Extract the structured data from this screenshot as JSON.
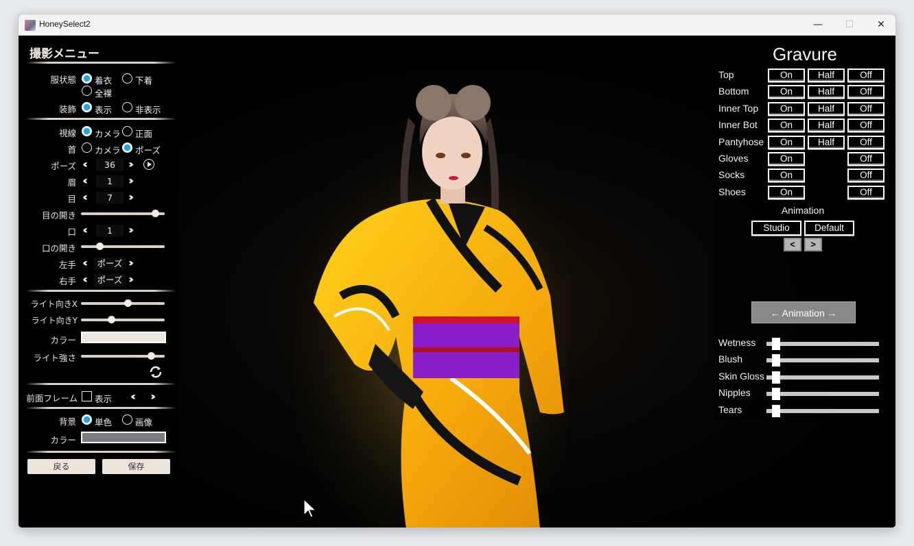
{
  "window": {
    "title": "HoneySelect2",
    "controls": {
      "minimize": "—",
      "maximize": "☐",
      "close": "✕"
    }
  },
  "left_menu": {
    "title": "撮影メニュー",
    "clothing_state": {
      "label": "服状態",
      "options": [
        "着衣",
        "下着",
        "全裸"
      ],
      "selected": "着衣"
    },
    "accessory": {
      "label": "装飾",
      "options": [
        "表示",
        "非表示"
      ],
      "selected": "表示"
    },
    "gaze": {
      "label": "視線",
      "options": [
        "カメラ",
        "正面"
      ],
      "selected": "カメラ"
    },
    "neck": {
      "label": "首",
      "options": [
        "カメラ",
        "ポーズ"
      ],
      "selected": "ポーズ"
    },
    "pose": {
      "label": "ポーズ",
      "value": "36"
    },
    "eyebrow": {
      "label": "眉",
      "value": "1"
    },
    "eye": {
      "label": "目",
      "value": "7"
    },
    "eye_open": {
      "label": "目の開き",
      "level": 0.93
    },
    "mouth": {
      "label": "口",
      "value": "1"
    },
    "mouth_open": {
      "label": "口の開き",
      "level": 0.2
    },
    "left_hand": {
      "label": "左手",
      "value": "ポーズ"
    },
    "right_hand": {
      "label": "右手",
      "value": "ポーズ"
    },
    "light_x": {
      "label": "ライト向きX",
      "level": 0.57
    },
    "light_y": {
      "label": "ライト向きY",
      "level": 0.35
    },
    "light_color": {
      "label": "カラー",
      "color": "#efe6e1"
    },
    "light_strength": {
      "label": "ライト強さ",
      "level": 0.87
    },
    "front_frame": {
      "label": "前面フレーム",
      "checkbox_label": "表示",
      "checked": false
    },
    "background": {
      "label": "背景",
      "options": [
        "単色",
        "画像"
      ],
      "selected": "単色"
    },
    "bg_color": {
      "label": "カラー",
      "color": "#7a7c83"
    },
    "back_button": "戻る",
    "save_button": "保存"
  },
  "gravure": {
    "title": "Gravure",
    "rows": [
      {
        "label": "Top",
        "buttons": [
          "On",
          "Half",
          "Off"
        ]
      },
      {
        "label": "Bottom",
        "buttons": [
          "On",
          "Half",
          "Off"
        ]
      },
      {
        "label": "Inner Top",
        "buttons": [
          "On",
          "Half",
          "Off"
        ]
      },
      {
        "label": "Inner Bot",
        "buttons": [
          "On",
          "Half",
          "Off"
        ]
      },
      {
        "label": "Pantyhose",
        "buttons": [
          "On",
          "Half",
          "Off"
        ]
      },
      {
        "label": "Gloves",
        "buttons": [
          "On",
          "",
          "Off"
        ]
      },
      {
        "label": "Socks",
        "buttons": [
          "On",
          "",
          "Off"
        ]
      },
      {
        "label": "Shoes",
        "buttons": [
          "On",
          "",
          "Off"
        ]
      }
    ],
    "animation_label": "Animation",
    "studio_button": "Studio",
    "default_button": "Default",
    "prev_button": "<",
    "next_button": ">",
    "animation_toggle": "← Animation →",
    "sliders": [
      {
        "label": "Wetness",
        "level": 0.0
      },
      {
        "label": "Blush",
        "level": 0.0
      },
      {
        "label": "Skin Gloss",
        "level": 0.0
      },
      {
        "label": "Nipples",
        "level": 0.0
      },
      {
        "label": "Tears",
        "level": 0.0
      }
    ]
  },
  "colors": {
    "accent_radio": "#1ea7e8",
    "kimono": "#f2b60a",
    "obi": "#8a1ec8"
  }
}
